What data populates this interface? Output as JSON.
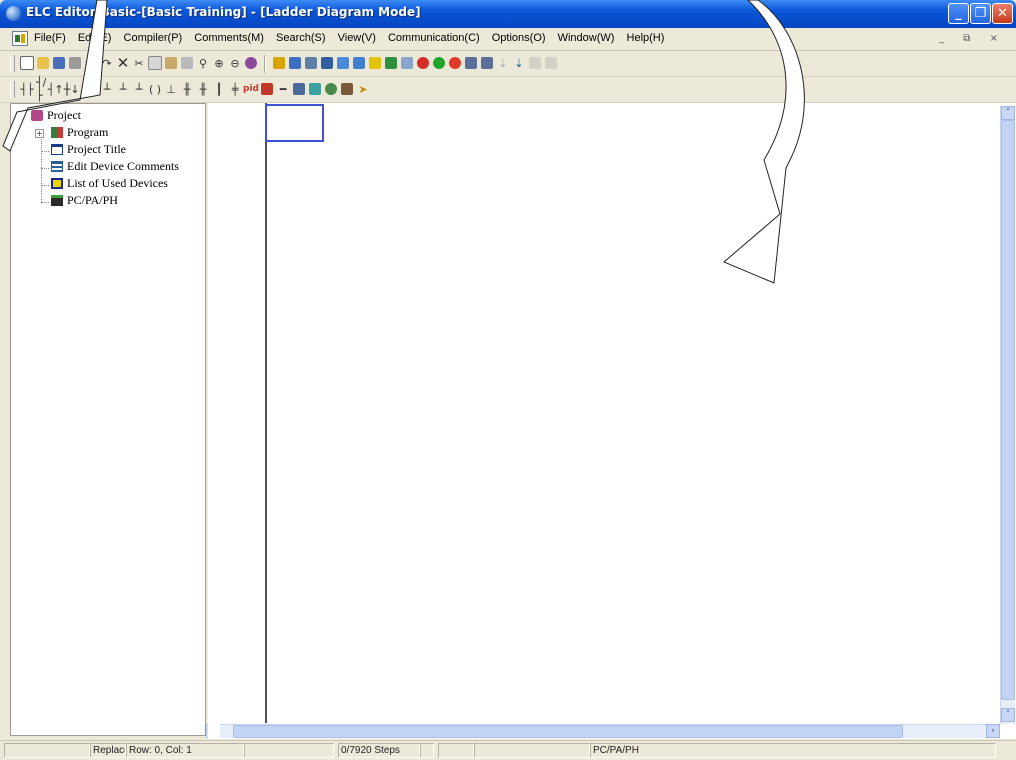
{
  "window": {
    "title": "ELC Editor-Basic-[Basic Training] - [Ladder Diagram Mode]",
    "min_glyph": "_",
    "max_glyph": "❐",
    "close_glyph": "✕"
  },
  "menu": {
    "items": [
      "File(F)",
      "Edit(E)",
      "Compiler(P)",
      "Comments(M)",
      "Search(S)",
      "View(V)",
      "Communication(C)",
      "Options(O)",
      "Window(W)",
      "Help(H)"
    ],
    "mdi_controls": "_ ⧉ ×"
  },
  "tree": {
    "root": "Project",
    "expander": "+",
    "items": [
      "Program",
      "Project Title",
      "Edit Device Comments",
      "List of Used Devices",
      "PC/PA/PH"
    ]
  },
  "status": {
    "mode": "Replace",
    "position": "Row: 0, Col: 1",
    "steps": "0/7920 Steps",
    "model": "PC/PA/PH"
  },
  "scroll": {
    "up": "˄",
    "down": "˅",
    "left": "‹",
    "right": "›"
  },
  "colors": {
    "title_bar": "#0a55d8",
    "cursor_box": "#3d53d4",
    "window_face": "#ece9d8"
  }
}
